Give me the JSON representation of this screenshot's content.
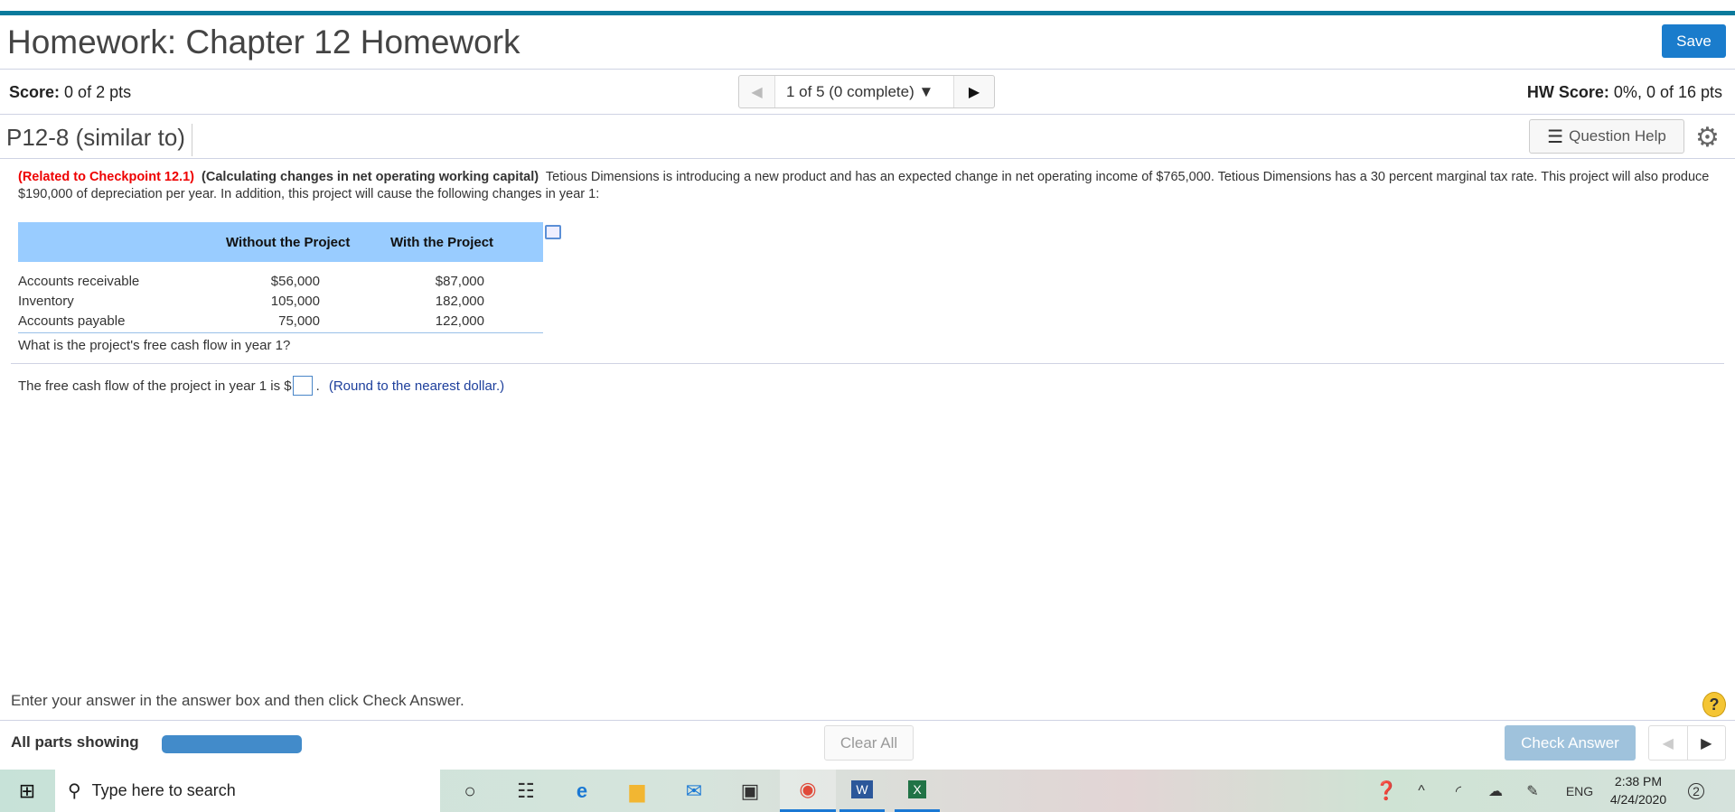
{
  "header": {
    "title": "Homework: Chapter 12 Homework",
    "save_label": "Save"
  },
  "score_bar": {
    "score_label": "Score:",
    "score_value": "0 of 2 pts",
    "nav_text": "1 of 5 (0 complete)",
    "hw_score_label": "HW Score:",
    "hw_score_value": "0%, 0 of 16 pts"
  },
  "question": {
    "id": "P12-8 (similar to)",
    "help_label": "Question Help",
    "related": "(Related to Checkpoint 12.1)",
    "topic": "(Calculating changes in net operating working capital)",
    "body": "Tetious Dimensions is introducing a new product and has an expected change in net operating income of $765,000.  Tetious Dimensions has a 30 percent marginal tax rate.  This project will also produce $190,000 of depreciation per year.  In addition, this project will cause the following changes in year 1:",
    "table": {
      "headers": [
        "Without the Project",
        "With the Project"
      ],
      "rows": [
        {
          "label": "Accounts receivable",
          "without": "$56,000",
          "with": "$87,000"
        },
        {
          "label": "Inventory",
          "without": "105,000",
          "with": "182,000"
        },
        {
          "label": "Accounts payable",
          "without": "75,000",
          "with": "122,000"
        }
      ]
    },
    "prompt": "What is the project's free cash flow in year 1?",
    "answer_prefix": "The free cash flow of the project in year 1 is $",
    "answer_value": "",
    "answer_suffix": ".",
    "hint": "(Round to the nearest dollar.)"
  },
  "footer": {
    "instruction": "Enter your answer in the answer box and then click Check Answer.",
    "all_parts": "All parts showing",
    "progress": 1.0,
    "clear_all": "Clear All",
    "check_answer": "Check Answer"
  },
  "taskbar": {
    "search_placeholder": "Type here to search",
    "lang": "ENG",
    "time": "2:38 PM",
    "date": "4/24/2020",
    "notifications": "2"
  },
  "colors": {
    "accent": "#0a7a9c",
    "save": "#1a7ccc",
    "table_header": "#99ccff",
    "related": "#ee0000"
  }
}
